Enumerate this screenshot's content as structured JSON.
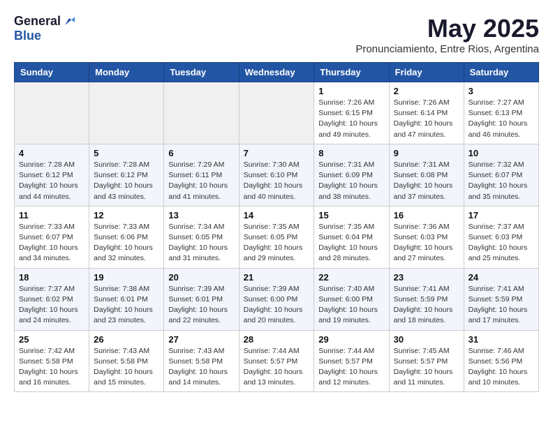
{
  "logo": {
    "general": "General",
    "blue": "Blue"
  },
  "title": "May 2025",
  "location": "Pronunciamiento, Entre Rios, Argentina",
  "headers": [
    "Sunday",
    "Monday",
    "Tuesday",
    "Wednesday",
    "Thursday",
    "Friday",
    "Saturday"
  ],
  "weeks": [
    [
      {
        "day": "",
        "info": ""
      },
      {
        "day": "",
        "info": ""
      },
      {
        "day": "",
        "info": ""
      },
      {
        "day": "",
        "info": ""
      },
      {
        "day": "1",
        "info": "Sunrise: 7:26 AM\nSunset: 6:15 PM\nDaylight: 10 hours\nand 49 minutes."
      },
      {
        "day": "2",
        "info": "Sunrise: 7:26 AM\nSunset: 6:14 PM\nDaylight: 10 hours\nand 47 minutes."
      },
      {
        "day": "3",
        "info": "Sunrise: 7:27 AM\nSunset: 6:13 PM\nDaylight: 10 hours\nand 46 minutes."
      }
    ],
    [
      {
        "day": "4",
        "info": "Sunrise: 7:28 AM\nSunset: 6:12 PM\nDaylight: 10 hours\nand 44 minutes."
      },
      {
        "day": "5",
        "info": "Sunrise: 7:28 AM\nSunset: 6:12 PM\nDaylight: 10 hours\nand 43 minutes."
      },
      {
        "day": "6",
        "info": "Sunrise: 7:29 AM\nSunset: 6:11 PM\nDaylight: 10 hours\nand 41 minutes."
      },
      {
        "day": "7",
        "info": "Sunrise: 7:30 AM\nSunset: 6:10 PM\nDaylight: 10 hours\nand 40 minutes."
      },
      {
        "day": "8",
        "info": "Sunrise: 7:31 AM\nSunset: 6:09 PM\nDaylight: 10 hours\nand 38 minutes."
      },
      {
        "day": "9",
        "info": "Sunrise: 7:31 AM\nSunset: 6:08 PM\nDaylight: 10 hours\nand 37 minutes."
      },
      {
        "day": "10",
        "info": "Sunrise: 7:32 AM\nSunset: 6:07 PM\nDaylight: 10 hours\nand 35 minutes."
      }
    ],
    [
      {
        "day": "11",
        "info": "Sunrise: 7:33 AM\nSunset: 6:07 PM\nDaylight: 10 hours\nand 34 minutes."
      },
      {
        "day": "12",
        "info": "Sunrise: 7:33 AM\nSunset: 6:06 PM\nDaylight: 10 hours\nand 32 minutes."
      },
      {
        "day": "13",
        "info": "Sunrise: 7:34 AM\nSunset: 6:05 PM\nDaylight: 10 hours\nand 31 minutes."
      },
      {
        "day": "14",
        "info": "Sunrise: 7:35 AM\nSunset: 6:05 PM\nDaylight: 10 hours\nand 29 minutes."
      },
      {
        "day": "15",
        "info": "Sunrise: 7:35 AM\nSunset: 6:04 PM\nDaylight: 10 hours\nand 28 minutes."
      },
      {
        "day": "16",
        "info": "Sunrise: 7:36 AM\nSunset: 6:03 PM\nDaylight: 10 hours\nand 27 minutes."
      },
      {
        "day": "17",
        "info": "Sunrise: 7:37 AM\nSunset: 6:03 PM\nDaylight: 10 hours\nand 25 minutes."
      }
    ],
    [
      {
        "day": "18",
        "info": "Sunrise: 7:37 AM\nSunset: 6:02 PM\nDaylight: 10 hours\nand 24 minutes."
      },
      {
        "day": "19",
        "info": "Sunrise: 7:38 AM\nSunset: 6:01 PM\nDaylight: 10 hours\nand 23 minutes."
      },
      {
        "day": "20",
        "info": "Sunrise: 7:39 AM\nSunset: 6:01 PM\nDaylight: 10 hours\nand 22 minutes."
      },
      {
        "day": "21",
        "info": "Sunrise: 7:39 AM\nSunset: 6:00 PM\nDaylight: 10 hours\nand 20 minutes."
      },
      {
        "day": "22",
        "info": "Sunrise: 7:40 AM\nSunset: 6:00 PM\nDaylight: 10 hours\nand 19 minutes."
      },
      {
        "day": "23",
        "info": "Sunrise: 7:41 AM\nSunset: 5:59 PM\nDaylight: 10 hours\nand 18 minutes."
      },
      {
        "day": "24",
        "info": "Sunrise: 7:41 AM\nSunset: 5:59 PM\nDaylight: 10 hours\nand 17 minutes."
      }
    ],
    [
      {
        "day": "25",
        "info": "Sunrise: 7:42 AM\nSunset: 5:58 PM\nDaylight: 10 hours\nand 16 minutes."
      },
      {
        "day": "26",
        "info": "Sunrise: 7:43 AM\nSunset: 5:58 PM\nDaylight: 10 hours\nand 15 minutes."
      },
      {
        "day": "27",
        "info": "Sunrise: 7:43 AM\nSunset: 5:58 PM\nDaylight: 10 hours\nand 14 minutes."
      },
      {
        "day": "28",
        "info": "Sunrise: 7:44 AM\nSunset: 5:57 PM\nDaylight: 10 hours\nand 13 minutes."
      },
      {
        "day": "29",
        "info": "Sunrise: 7:44 AM\nSunset: 5:57 PM\nDaylight: 10 hours\nand 12 minutes."
      },
      {
        "day": "30",
        "info": "Sunrise: 7:45 AM\nSunset: 5:57 PM\nDaylight: 10 hours\nand 11 minutes."
      },
      {
        "day": "31",
        "info": "Sunrise: 7:46 AM\nSunset: 5:56 PM\nDaylight: 10 hours\nand 10 minutes."
      }
    ]
  ]
}
